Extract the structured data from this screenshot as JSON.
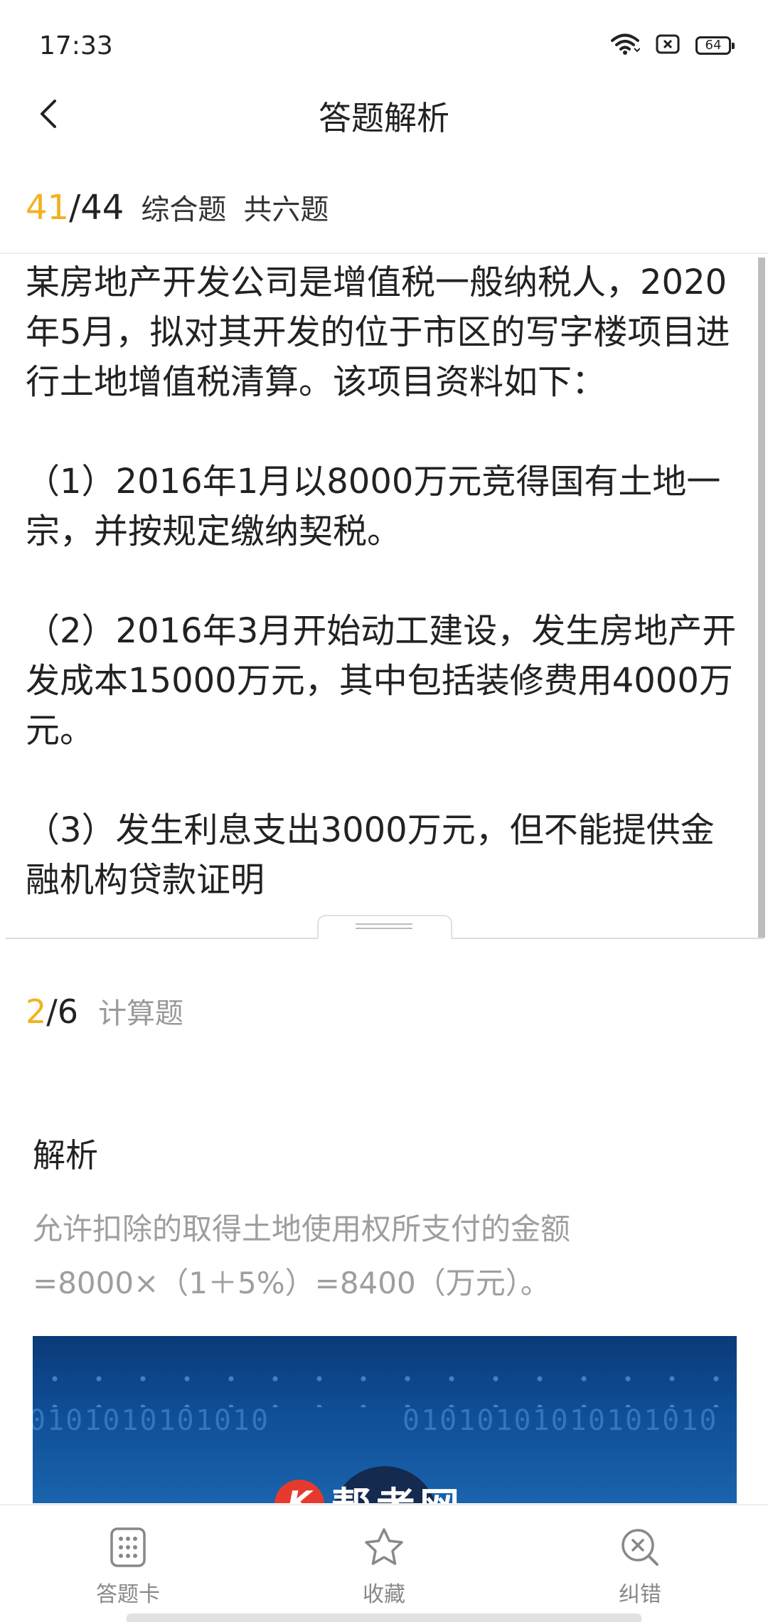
{
  "status": {
    "time": "17:33",
    "battery": "64"
  },
  "header": {
    "title": "答题解析"
  },
  "progress": {
    "current": "41",
    "total": "44",
    "type": "综合题",
    "count": "共六题"
  },
  "stem": {
    "p1": "某房地产开发公司是增值税一般纳税人，2020年5月，拟对其开发的位于市区的写字楼项目进行土地增值税清算。该项目资料如下：",
    "p2": "（1）2016年1月以8000万元竞得国有土地一宗，并按规定缴纳契税。",
    "p3": "（2）2016年3月开始动工建设，发生房地产开发成本15000万元，其中包括装修费用4000万元。",
    "p4": "（3）发生利息支出3000万元，但不能提供金融机构贷款证明"
  },
  "sub_progress": {
    "current": "2",
    "total": "6",
    "type": "计算题"
  },
  "analysis": {
    "title": "解析",
    "line1": "允许扣除的取得土地使用权所支付的金额",
    "line2": "=8000×（1＋5%）=8400（万元）。"
  },
  "banner": {
    "binary_left": "0101010101010",
    "binary_right": "01010101010101010",
    "logo_mark": "K",
    "logo_text": "帮考网"
  },
  "tabs": {
    "card": "答题卡",
    "favorite": "收藏",
    "error": "纠错"
  },
  "colors": {
    "accent": "#f2b21f",
    "muted": "#9e9e9e"
  }
}
